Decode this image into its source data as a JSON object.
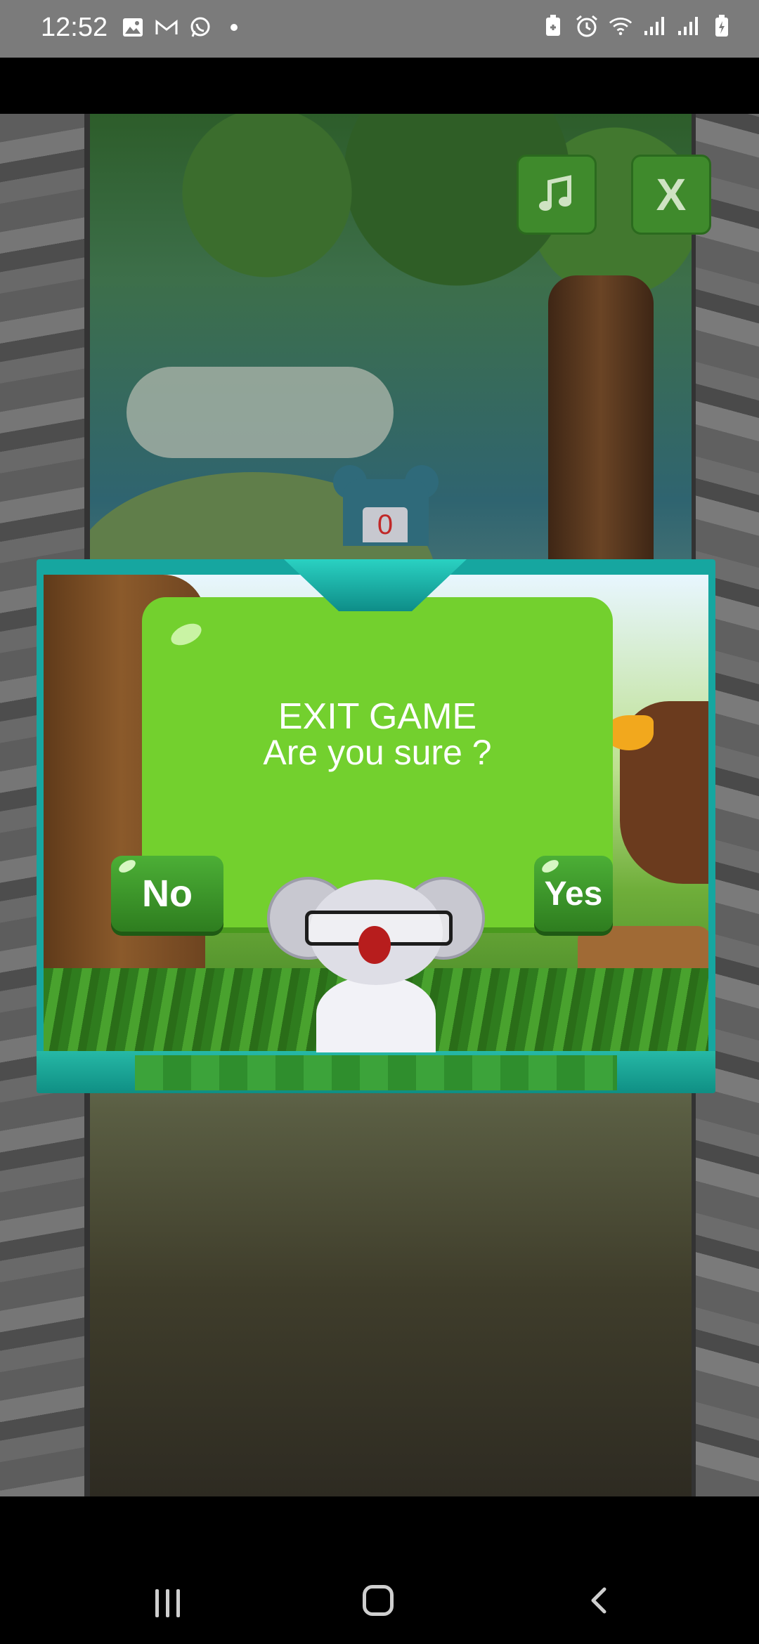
{
  "status_bar": {
    "time": "12:52",
    "left_icons": [
      "image-icon",
      "gmail-icon",
      "whatsapp-icon",
      "dot-icon"
    ],
    "right_icons": [
      "battery-saver-icon",
      "alarm-icon",
      "wifi-icon",
      "signal-icon",
      "signal-icon",
      "battery-charging-icon"
    ]
  },
  "game": {
    "score": "0",
    "music_button_icon": "music-note-icon",
    "exit_button_label": "X"
  },
  "dialog": {
    "title": "EXIT GAME",
    "question": "Are you sure ?",
    "no_label": "No",
    "yes_label": "Yes"
  },
  "nav_bar": {
    "recents_icon": "recents-icon",
    "home_icon": "home-icon",
    "back_icon": "back-icon"
  },
  "colors": {
    "dialog_panel": "#73d02e",
    "dialog_frame": "#16a6a0",
    "button_green": "#3f8a2c",
    "score_text": "#c02828"
  }
}
